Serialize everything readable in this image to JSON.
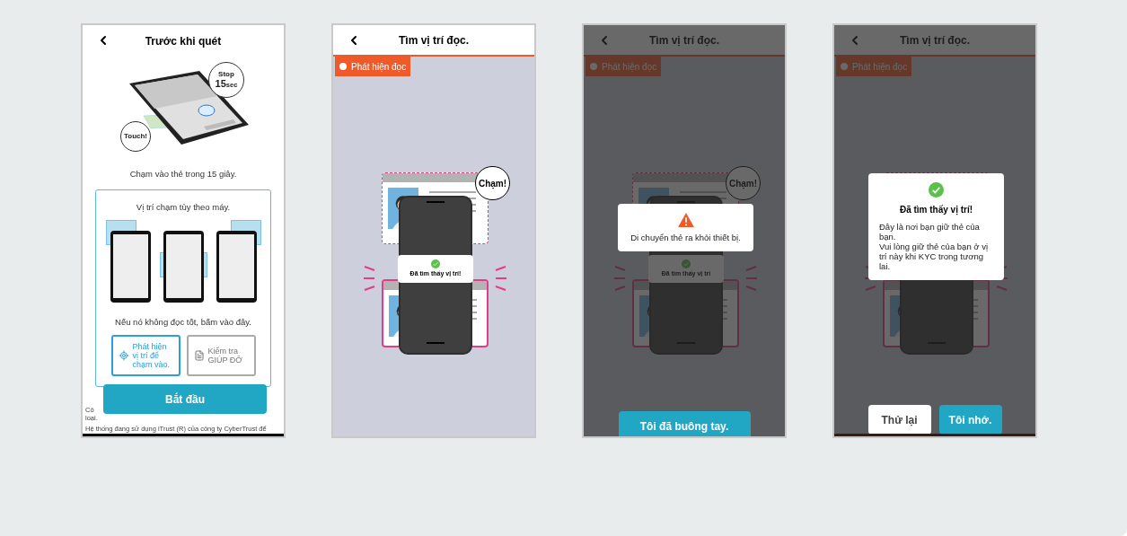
{
  "screens": [
    {
      "kind": "intro",
      "title": "Trước khi quét",
      "bubble_stop": "Stop",
      "bubble_secs": "15",
      "bubble_unit": "sec",
      "bubble_touch": "Touch!",
      "instruction": "Chạm vào thẻ trong 15 giây.",
      "panel_title": "Vị trí chạm tùy theo máy.",
      "panel_hint": "Nếu nó không đọc tốt, bấm vào đây.",
      "options": [
        {
          "kind": "locate",
          "label": "Phát hiện vị trí để chạm vào.",
          "selected": true
        },
        {
          "kind": "help",
          "label": "Kiểm tra GIÚP ĐỠ",
          "selected": false
        }
      ],
      "primary_button": "Bắt đầu",
      "footer_fragments": [
        "Cô",
        "loại."
      ],
      "footer": "Hệ thống đang sử dụng iTrust (R) của công ty CyberTrust để"
    },
    {
      "kind": "detect",
      "title": "Tìm vị trí đọc.",
      "status": "Phát hiện đọc",
      "dimmed": false,
      "bubble": "Chạm!",
      "toast": "Đã tìm thấy vị trí!"
    },
    {
      "kind": "detect",
      "title": "Tìm vị trí đọc.",
      "status": "Phát hiện đọc",
      "dimmed": true,
      "bubble": "Chạm!",
      "toast": "Đã tìm thấy vị trí",
      "dialog": {
        "kind": "warning",
        "message_lines": [
          "Di chuyển thẻ ra khỏi thiết bị."
        ]
      },
      "buttons": [
        {
          "label": "Tôi đã buông tay.",
          "kind": "primary"
        }
      ]
    },
    {
      "kind": "detect",
      "title": "Tìm vị trí đọc.",
      "status": "Phát hiện đọc",
      "dimmed": true,
      "dialog": {
        "kind": "success",
        "title": "Đã tìm thấy vị trí!",
        "message_lines": [
          "Đây là nơi bạn giữ thẻ của bạn.",
          "Vui lòng giữ thẻ của bạn ở vị trí này khi KYC trong tương lai."
        ]
      },
      "buttons": [
        {
          "label": "Thử lại",
          "kind": "secondary"
        },
        {
          "label": "Tôi nhớ.",
          "kind": "primary"
        }
      ]
    }
  ]
}
